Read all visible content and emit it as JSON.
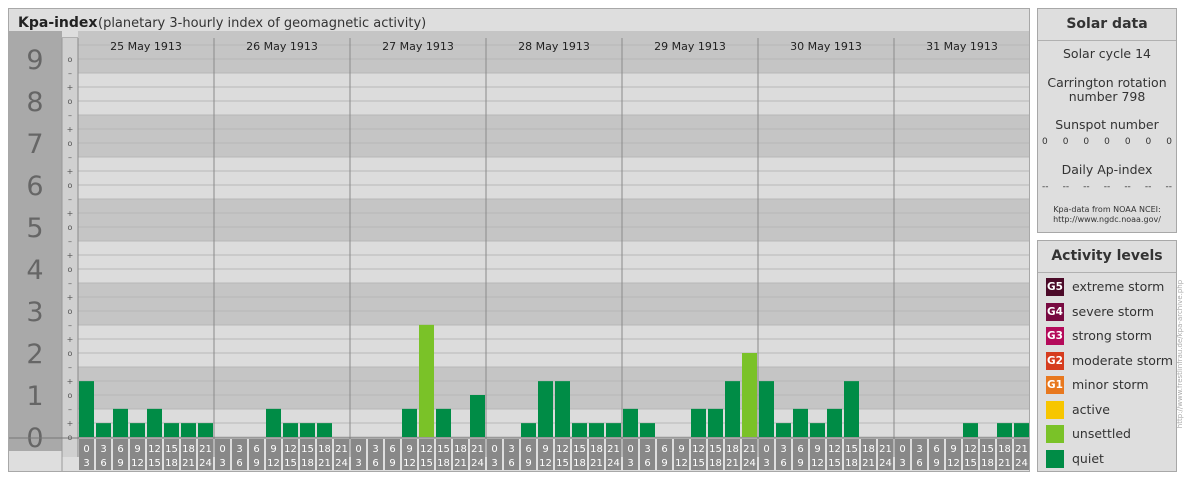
{
  "header": {
    "title": "Kpa-index",
    "subtitle": "(planetary 3-hourly index of geomagnetic activity)"
  },
  "chart_data": {
    "type": "bar",
    "days": [
      "25 May 1913",
      "26 May 1913",
      "27 May 1913",
      "28 May 1913",
      "29 May 1913",
      "30 May 1913",
      "31 May 1913"
    ],
    "interval_starts": [
      "0",
      "3",
      "6",
      "9",
      "12",
      "15",
      "18",
      "21"
    ],
    "interval_ends": [
      "3",
      "6",
      "9",
      "12",
      "15",
      "18",
      "21",
      "24"
    ],
    "y_labels": [
      "0",
      "1",
      "2",
      "3",
      "4",
      "5",
      "6",
      "7",
      "8",
      "9"
    ],
    "sub_labels": [
      "–",
      "o",
      "+"
    ],
    "ylim": [
      0,
      9.33
    ],
    "values": [
      [
        1.33,
        0.33,
        0.67,
        0.33,
        0.67,
        0.33,
        0.33,
        0.33
      ],
      [
        0,
        0,
        0,
        0.67,
        0.33,
        0.33,
        0.33,
        0
      ],
      [
        0,
        0,
        0,
        0.67,
        2.67,
        0.67,
        0,
        1
      ],
      [
        0,
        0,
        0.33,
        1.33,
        1.33,
        0.33,
        0.33,
        0.33
      ],
      [
        0.67,
        0.33,
        0,
        0,
        0.67,
        0.67,
        1.33,
        2
      ],
      [
        1.33,
        0.33,
        0.67,
        0.33,
        0.67,
        1.33,
        0,
        0
      ],
      [
        0,
        0,
        0,
        0,
        0.33,
        0,
        0.33,
        0.33
      ]
    ],
    "colors": {
      "quiet": "#008c46",
      "unsettled": "#7ac228",
      "active": "#f7c600"
    }
  },
  "solar": {
    "title": "Solar data",
    "cycle": "Solar cycle 14",
    "carrington_1": "Carrington rotation",
    "carrington_2": "number 798",
    "sunspot_label": "Sunspot number",
    "sunspots": [
      "0",
      "0",
      "0",
      "0",
      "0",
      "0",
      "0"
    ],
    "ap_label": "Daily Ap-index",
    "ap_values": [
      "--",
      "--",
      "--",
      "--",
      "--",
      "--",
      "--"
    ],
    "source_1": "Kpa-data from NOAA NCEI:",
    "source_2": "http://www.ngdc.noaa.gov/"
  },
  "activity": {
    "title": "Activity levels",
    "levels": [
      {
        "badge": "G5",
        "label": "extreme storm",
        "color": "#4b0a28"
      },
      {
        "badge": "G4",
        "label": "severe storm",
        "color": "#780a41"
      },
      {
        "badge": "G3",
        "label": "strong storm",
        "color": "#b40a5a"
      },
      {
        "badge": "G2",
        "label": "moderate storm",
        "color": "#d63c1e"
      },
      {
        "badge": "G1",
        "label": "minor storm",
        "color": "#e8781e"
      },
      {
        "badge": "",
        "label": "active",
        "color": "#f7c600"
      },
      {
        "badge": "",
        "label": "unsettled",
        "color": "#7ac228"
      },
      {
        "badge": "",
        "label": "quiet",
        "color": "#008c46"
      }
    ]
  },
  "credit": "http://www.frestlinfrau.de/kpa-archive.php"
}
